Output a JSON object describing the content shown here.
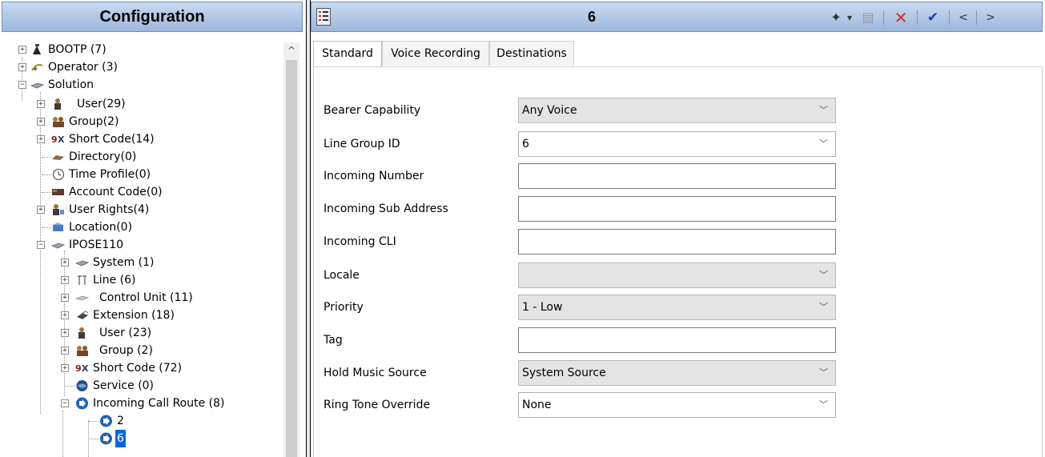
{
  "left_panel": {
    "title": "Configuration",
    "tree": [
      {
        "label": "BOOTP (7)",
        "icon": "bootp-icon"
      },
      {
        "label": "Operator (3)",
        "icon": "operator-icon"
      },
      {
        "label": "Solution",
        "icon": "solution-icon"
      },
      {
        "label": "User(29)",
        "icon": "user-icon"
      },
      {
        "label": "Group(2)",
        "icon": "group-icon"
      },
      {
        "label": "Short Code(14)",
        "icon": "short-code-icon"
      },
      {
        "label": "Directory(0)",
        "icon": "directory-icon"
      },
      {
        "label": "Time Profile(0)",
        "icon": "clock-icon"
      },
      {
        "label": "Account Code(0)",
        "icon": "account-code-icon"
      },
      {
        "label": "User Rights(4)",
        "icon": "user-rights-icon"
      },
      {
        "label": "Location(0)",
        "icon": "location-icon"
      },
      {
        "label": "IPOSE110",
        "icon": "system-unit-icon"
      },
      {
        "label": "System (1)",
        "icon": "system-unit-icon"
      },
      {
        "label": "Line (6)",
        "icon": "line-icon"
      },
      {
        "label": "Control Unit (11)",
        "icon": "control-unit-icon"
      },
      {
        "label": "Extension (18)",
        "icon": "extension-icon"
      },
      {
        "label": "User (23)",
        "icon": "user-icon"
      },
      {
        "label": "Group (2)",
        "icon": "group-icon"
      },
      {
        "label": "Short Code (72)",
        "icon": "short-code-icon"
      },
      {
        "label": "Service (0)",
        "icon": "service-icon"
      },
      {
        "label": "Incoming Call Route (8)",
        "icon": "incoming-call-route-icon"
      },
      {
        "label": "2",
        "icon": "incoming-call-route-icon"
      },
      {
        "label": "6",
        "icon": "incoming-call-route-icon"
      }
    ],
    "scroll_up_glyph": "^"
  },
  "right_panel": {
    "title": "6",
    "toolbar": {
      "new_glyph": "✦",
      "dropdown_glyph": "▾",
      "export_glyph": "▤",
      "cancel_glyph": "✕",
      "ok_glyph": "✔",
      "prev_glyph": "<",
      "next_glyph": ">"
    },
    "tabs": [
      "Standard",
      "Voice Recording",
      "Destinations"
    ],
    "active_tab": "Standard",
    "fields": [
      {
        "label": "Bearer Capability",
        "value": "Any Voice",
        "type": "select-disabled"
      },
      {
        "label": "Line Group ID",
        "value": "6",
        "type": "combo"
      },
      {
        "label": "Incoming Number",
        "value": "",
        "type": "text"
      },
      {
        "label": "Incoming Sub Address",
        "value": "",
        "type": "text"
      },
      {
        "label": "Incoming CLI",
        "value": "",
        "type": "text"
      },
      {
        "label": "Locale",
        "value": "",
        "type": "select-disabled"
      },
      {
        "label": "Priority",
        "value": "1 - Low",
        "type": "select-disabled"
      },
      {
        "label": "Tag",
        "value": "",
        "type": "text"
      },
      {
        "label": "Hold Music Source",
        "value": "System Source",
        "type": "select-disabled"
      },
      {
        "label": "Ring Tone Override",
        "value": "None",
        "type": "combo"
      }
    ],
    "dropdown_arrow_glyph": "﹀"
  },
  "colors": {
    "header_gradient_top": "#c9daf0",
    "header_gradient_bottom": "#9cb7dd",
    "selection": "#0a64d8",
    "cancel_red": "#d6282b",
    "ok_blue": "#1d3fa3",
    "call_route_blue": "#1e63b5"
  }
}
